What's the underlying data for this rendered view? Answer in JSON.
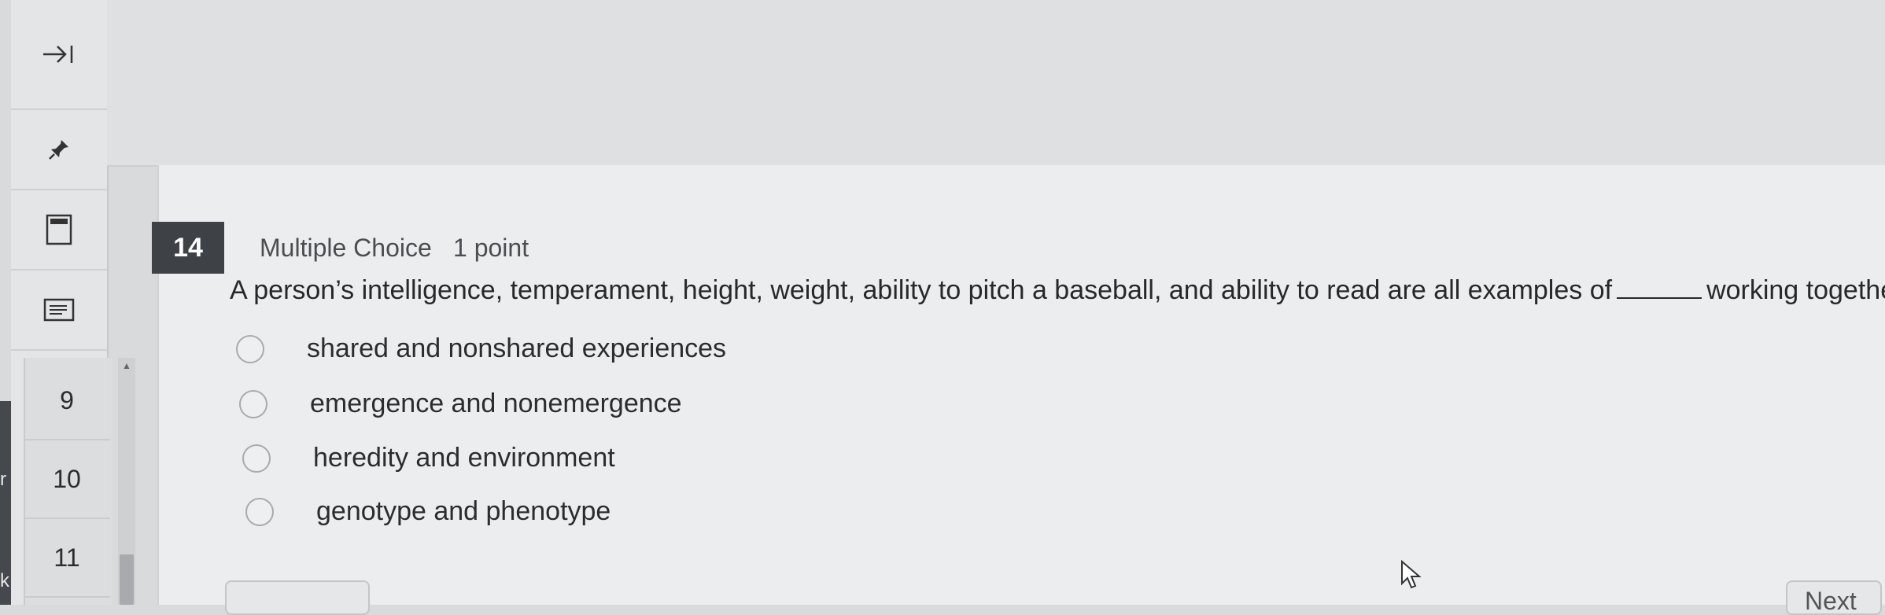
{
  "sidebar": {
    "tools": [
      {
        "icon": "collapse-panel-icon"
      },
      {
        "icon": "pin-icon"
      },
      {
        "icon": "calculator-icon"
      },
      {
        "icon": "notepad-icon"
      }
    ],
    "question_numbers": [
      "9",
      "10",
      "11"
    ],
    "edge_glyphs": [
      "r",
      "k"
    ]
  },
  "question": {
    "number": "14",
    "type": "Multiple Choice",
    "points": "1 point",
    "prompt_before": "A person’s intelligence, temperament, height, weight, ability to pitch a baseball, and ability to read are all examples of",
    "prompt_after": "working together.",
    "options": [
      "shared and nonshared experiences",
      "emergence and nonemergence",
      "heredity and environment",
      "genotype and phenotype"
    ]
  },
  "footer": {
    "next_label": "Next"
  },
  "colors": {
    "question_badge": "#3e4247",
    "card_background": "#ecedee"
  }
}
